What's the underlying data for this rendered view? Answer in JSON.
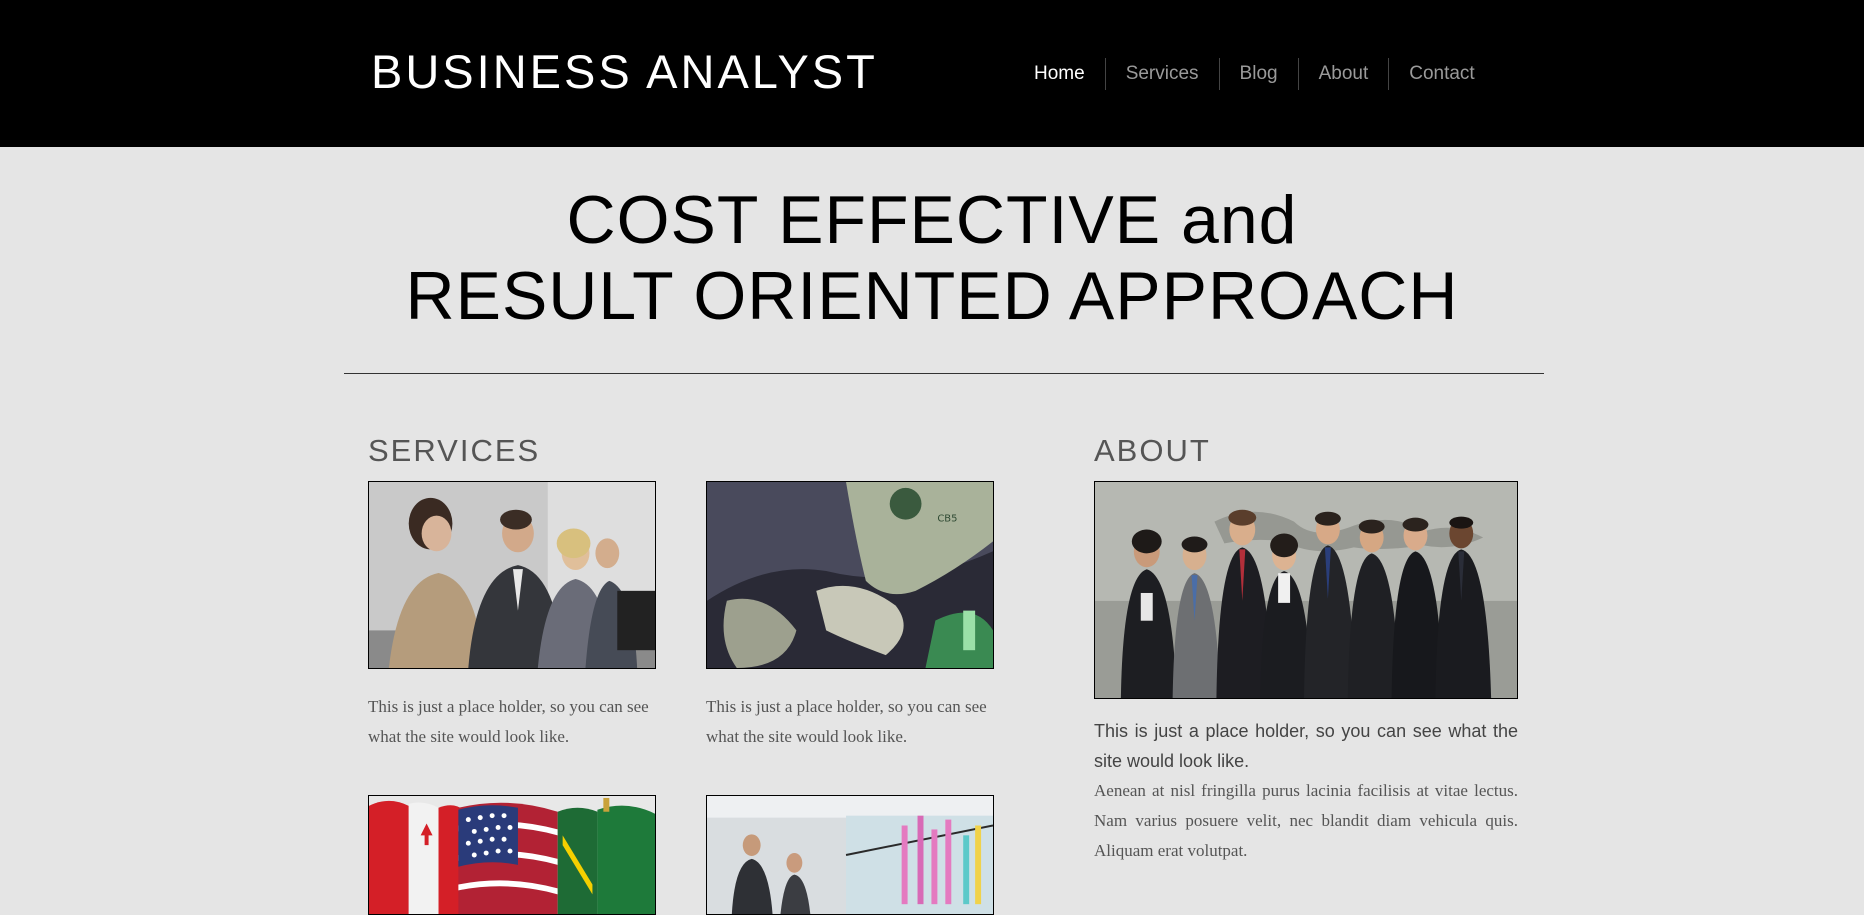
{
  "header": {
    "logo": "BUSINESS ANALYST",
    "nav": [
      {
        "label": "Home",
        "active": true
      },
      {
        "label": "Services",
        "active": false
      },
      {
        "label": "Blog",
        "active": false
      },
      {
        "label": "About",
        "active": false
      },
      {
        "label": "Contact",
        "active": false
      }
    ]
  },
  "hero": {
    "line1": "COST EFFECTIVE and",
    "line2": "RESULT ORIENTED APPROACH"
  },
  "services": {
    "title": "SERVICES",
    "items": [
      {
        "image": "call-center-team-image",
        "caption": "This is just a place holder, so you can see what the site would look like."
      },
      {
        "image": "dollar-puzzle-image",
        "caption": "This is just a place holder, so you can see what the site would look like."
      },
      {
        "image": "world-flags-image",
        "caption": ""
      },
      {
        "image": "presentation-chart-image",
        "caption": ""
      }
    ]
  },
  "about": {
    "title": "ABOUT",
    "image": "business-team-image",
    "lead": "This is just a place holder, so you can see what the site would look like.",
    "body": "Aenean at nisl fringilla purus lacinia facilisis at vitae lectus. Nam varius posuere velit, nec blandit diam vehicula quis. Aliquam erat volutpat."
  },
  "colors": {
    "header_bg": "#000000",
    "page_bg": "#e5e5e5",
    "nav_active": "#ffffff",
    "nav_inactive": "#9a9a9a"
  }
}
